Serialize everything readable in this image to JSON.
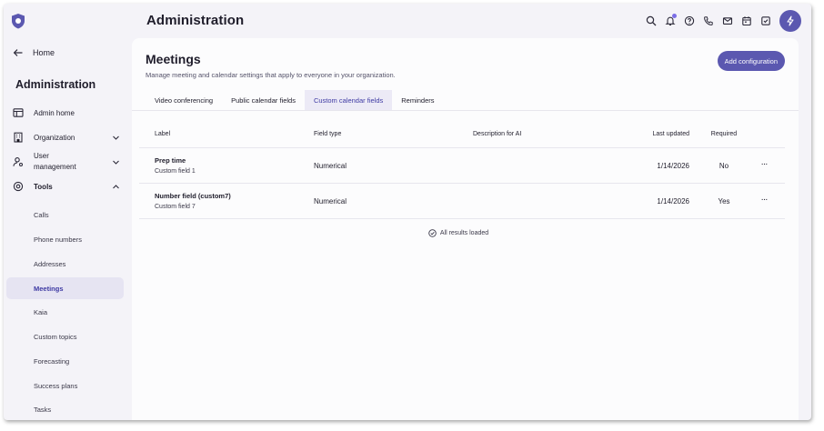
{
  "app": {
    "title": "Administration"
  },
  "sidebar": {
    "home_label": "Home",
    "title": "Administration",
    "nav": [
      {
        "label": "Admin home",
        "icon": "window-icon"
      },
      {
        "label": "Organization",
        "icon": "building-icon"
      },
      {
        "label": "User management",
        "icon": "user-gear-icon"
      },
      {
        "label": "Tools",
        "icon": "tools-icon"
      }
    ],
    "tools_items": [
      "Calls",
      "Phone numbers",
      "Addresses",
      "Meetings",
      "Kaia",
      "Custom topics",
      "Forecasting",
      "Success plans",
      "Tasks"
    ],
    "active_item": "Meetings"
  },
  "header_icons": [
    "search-icon",
    "bell-icon",
    "help-icon",
    "phone-icon",
    "mail-icon",
    "calendar-icon",
    "tasks-icon",
    "bolt-icon"
  ],
  "main": {
    "title": "Meetings",
    "description": "Manage meeting and calendar settings that apply to everyone in your organization.",
    "add_button": "Add configuration",
    "tabs": [
      "Video conferencing",
      "Public calendar fields",
      "Custom calendar fields",
      "Reminders"
    ],
    "active_tab": "Custom calendar fields",
    "table": {
      "columns": [
        "Label",
        "Field type",
        "Description for AI",
        "Last updated",
        "Required"
      ],
      "rows": [
        {
          "label": "Prep time",
          "sublabel": "Custom field 1",
          "field_type": "Numerical",
          "description": "",
          "updated": "1/14/2026",
          "required": "No",
          "more": "···"
        },
        {
          "label": "Number field (custom7)",
          "sublabel": "Custom field 7",
          "field_type": "Numerical",
          "description": "",
          "updated": "1/14/2026",
          "required": "Yes",
          "more": "···"
        }
      ]
    },
    "footer": "All results loaded"
  },
  "colors": {
    "accent": "#5b58b0",
    "accent_text": "#3e3aa3",
    "active_bg": "#e6e4f2",
    "panel": "#fcfcfd",
    "sidebar_bg": "#f4f3f8"
  }
}
